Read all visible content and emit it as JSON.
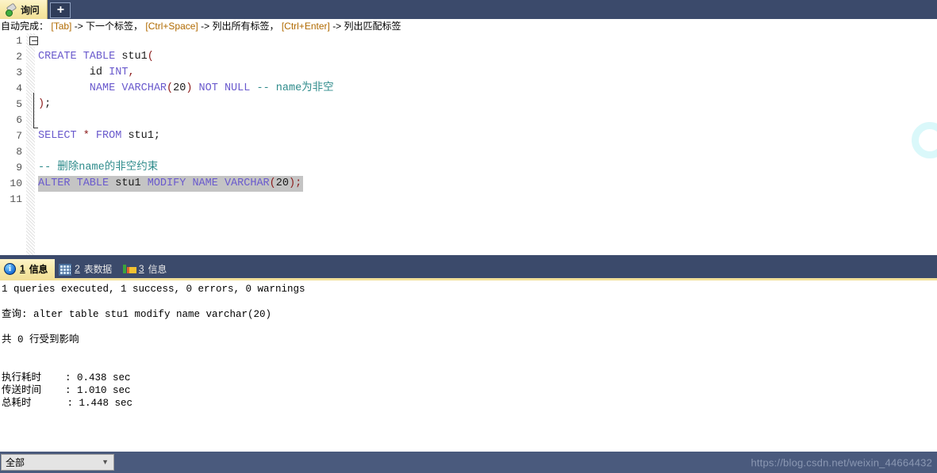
{
  "window": {
    "accent_yellow": "#f2e099",
    "navy": "#3b4a6b",
    "statusbar_bg": "#4a5a7d"
  },
  "query_tabs": {
    "tabs": [
      {
        "label": "询问",
        "icon": "plug-query-icon",
        "active": true
      }
    ],
    "new_tab_label": "+"
  },
  "hintbar": {
    "prefix": "自动完成：",
    "items": [
      {
        "key": "[Tab]",
        "desc": "-> 下一个标签，"
      },
      {
        "key": "[Ctrl+Space]",
        "desc": "-> 列出所有标签，"
      },
      {
        "key": "[Ctrl+Enter]",
        "desc": "-> 列出匹配标签"
      }
    ],
    "full_text": "自动完成： [Tab]-> 下一个标签， [Ctrl+Space]-> 列出所有标签， [Ctrl+Enter]-> 列出匹配标签"
  },
  "editor": {
    "lines": [
      {
        "n": "1",
        "text": ""
      },
      {
        "n": "2",
        "text": "CREATE TABLE stu1("
      },
      {
        "n": "3",
        "text": "        id INT,"
      },
      {
        "n": "4",
        "text": "        NAME VARCHAR(20) NOT NULL -- name为非空"
      },
      {
        "n": "5",
        "text": ");"
      },
      {
        "n": "6",
        "text": ""
      },
      {
        "n": "7",
        "text": "SELECT * FROM stu1;"
      },
      {
        "n": "8",
        "text": ""
      },
      {
        "n": "9",
        "text": "-- 删除name的非空约束"
      },
      {
        "n": "10",
        "text": "ALTER TABLE stu1 MODIFY NAME VARCHAR(20);"
      },
      {
        "n": "11",
        "text": ""
      }
    ],
    "selected_line": "10",
    "fold_marker_line": "2",
    "colors": {
      "keyword": "#6a5acd",
      "identifier": "#1a1a1a",
      "paren": "#8b1a1a",
      "comment": "#2e8b8b",
      "selection": "#c4c4c4"
    }
  },
  "result_tabs": [
    {
      "n": "1",
      "label": "信息",
      "icon": "info-icon",
      "active": true
    },
    {
      "n": "2",
      "label": "表数据",
      "icon": "grid-icon",
      "active": false
    },
    {
      "n": "3",
      "label": "信息",
      "icon": "chart-icon",
      "active": false
    }
  ],
  "output": {
    "summary": "1 queries executed, 1 success, 0 errors, 0 warnings",
    "query_label": "查询: alter table stu1 modify name varchar(20)",
    "rows_affected": "共 0 行受到影响",
    "timings": [
      {
        "label": "执行耗时",
        "value": ": 0.438 sec",
        "raw": "执行耗时    : 0.438 sec"
      },
      {
        "label": "传送时间",
        "value": ": 1.010 sec",
        "raw": "传送时间    : 1.010 sec"
      },
      {
        "label": "总耗时",
        "value": ": 1.448 sec",
        "raw": "总耗时      : 1.448 sec"
      }
    ]
  },
  "statusbar": {
    "filter_value": "全部",
    "filter_arrow": "▼",
    "watermark": "https://blog.csdn.net/weixin_44664432"
  }
}
